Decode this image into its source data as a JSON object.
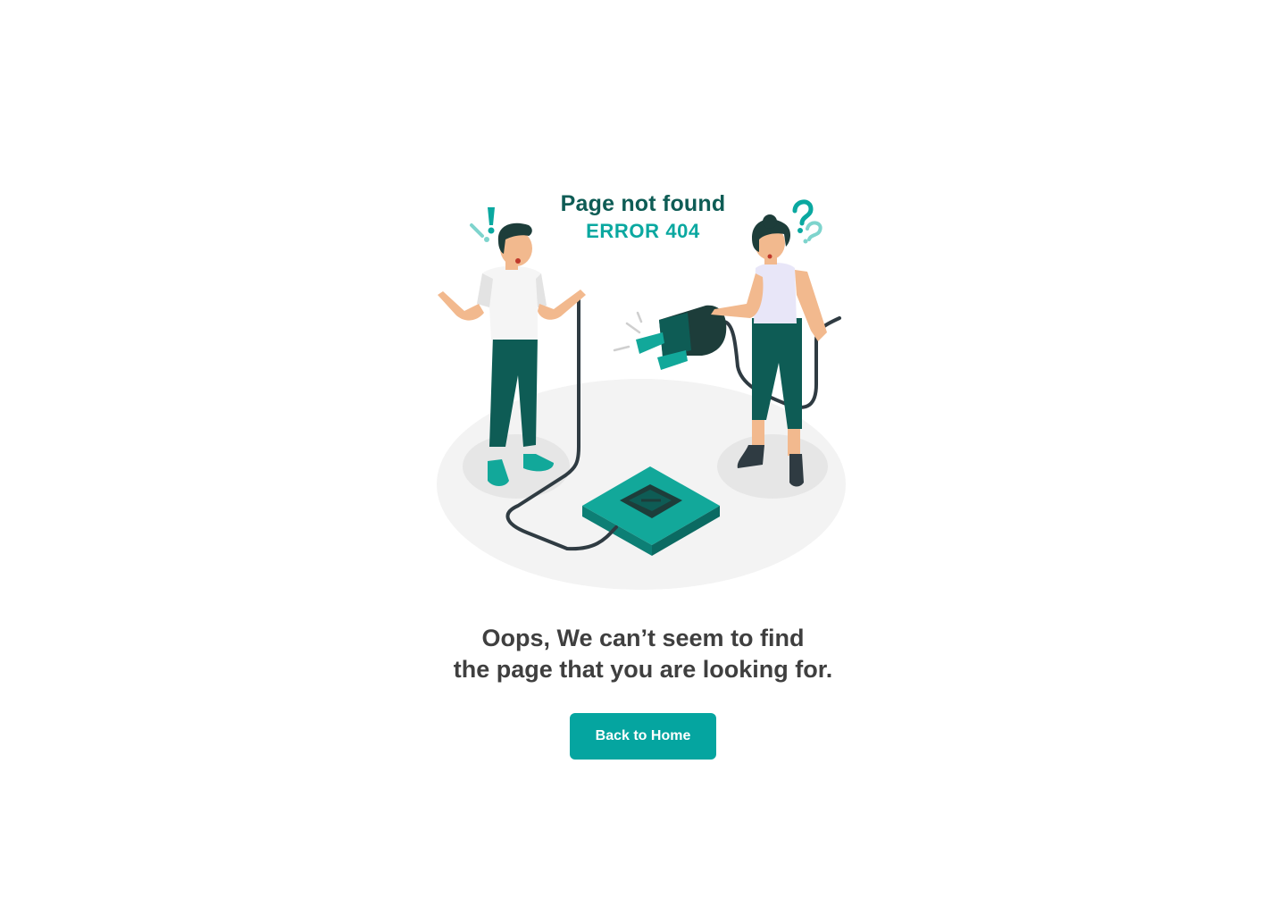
{
  "illustration": {
    "title": "Page not found",
    "subtitle": "ERROR 404",
    "colors": {
      "dark_teal": "#0e5c55",
      "teal": "#0aa8a0",
      "floor": "#f3f3f3",
      "shadow": "#e4e4e4",
      "skin": "#f2b98e",
      "cable": "#2f3b42"
    }
  },
  "message": {
    "line1": "Oops, We can’t seem to find",
    "line2": "the page that you are looking for."
  },
  "actions": {
    "home_label": "Back to Home",
    "accent_color": "#05a5a0"
  }
}
